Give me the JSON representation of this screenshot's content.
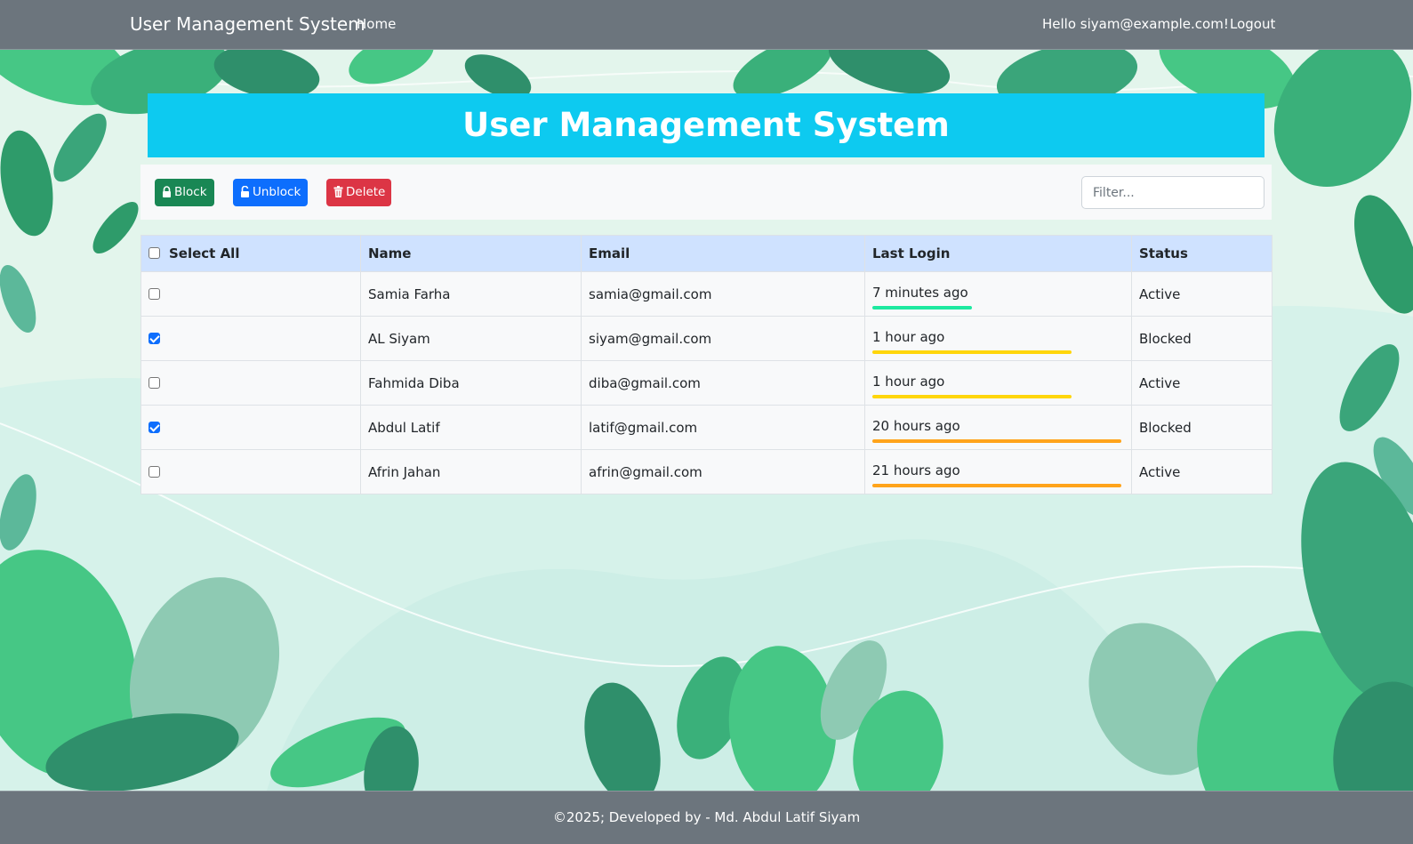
{
  "navbar": {
    "brand": "User Management System",
    "home_label": "Home",
    "greeting": "Hello siyam@example.com!",
    "logout_label": "Logout"
  },
  "header": {
    "title": "User Management System"
  },
  "toolbar": {
    "block_label": "Block",
    "unblock_label": "Unblock",
    "delete_label": "Delete",
    "block_icon": "lock-icon",
    "unblock_icon": "unlock-icon",
    "delete_icon": "trash-icon",
    "filter_placeholder": "Filter...",
    "filter_value": ""
  },
  "table": {
    "columns": [
      "Select All",
      "Name",
      "Email",
      "Last Login",
      "Status"
    ],
    "rows": [
      {
        "checked": false,
        "name": "Samia Farha",
        "email": "samia@gmail.com",
        "last_login": "7 minutes ago",
        "activity_level": 0.4,
        "bar_color": "#1de9a0",
        "status": "Active"
      },
      {
        "checked": true,
        "name": "AL Siyam",
        "email": "siyam@gmail.com",
        "last_login": "1 hour ago",
        "activity_level": 0.8,
        "bar_color": "#ffd60a",
        "status": "Blocked"
      },
      {
        "checked": false,
        "name": "Fahmida Diba",
        "email": "diba@gmail.com",
        "last_login": "1 hour ago",
        "activity_level": 0.8,
        "bar_color": "#ffd60a",
        "status": "Active"
      },
      {
        "checked": true,
        "name": "Abdul Latif",
        "email": "latif@gmail.com",
        "last_login": "20 hours ago",
        "activity_level": 1.0,
        "bar_color": "#ffa41b",
        "status": "Blocked"
      },
      {
        "checked": false,
        "name": "Afrin Jahan",
        "email": "afrin@gmail.com",
        "last_login": "21 hours ago",
        "activity_level": 1.0,
        "bar_color": "#ffa41b",
        "status": "Active"
      }
    ]
  },
  "footer": {
    "text": "©2025; Developed by - Md. Abdul Latif Siyam"
  },
  "colors": {
    "navbar_bg": "#6c757d",
    "banner_bg": "#0dcaf0",
    "block_btn": "#198754",
    "unblock_btn": "#0d6efd",
    "delete_btn": "#dc3545",
    "table_header_bg": "#cfe2ff"
  }
}
